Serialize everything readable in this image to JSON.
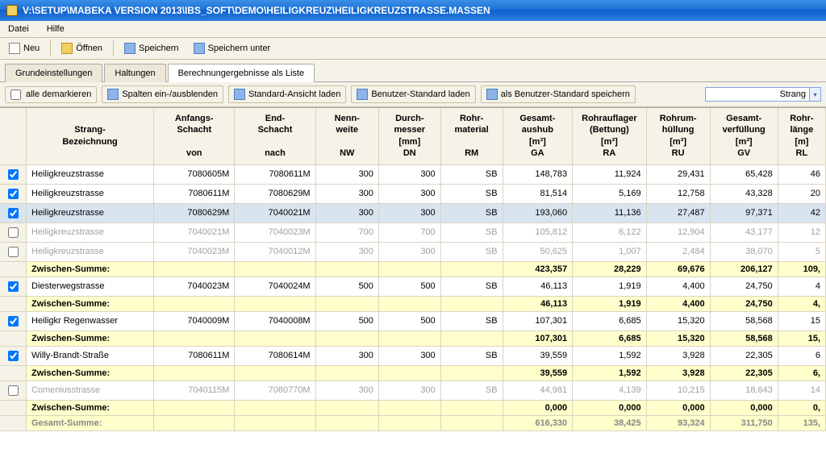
{
  "window_title": "V:\\SETUP\\MABEKA VERSION 2013\\IBS_SOFT\\DEMO\\HEILIGKREUZ\\HEILIGKREUZSTRASSE.MASSEN",
  "menu": {
    "datei": "Datei",
    "hilfe": "Hilfe"
  },
  "toolbar": {
    "neu": "Neu",
    "oeffnen": "Öffnen",
    "speichern": "Speichern",
    "speichern_unter": "Speichern unter"
  },
  "tabs": {
    "grund": "Grundeinstellungen",
    "haltungen": "Haltungen",
    "ergebnisse": "Berechnungergebnisse als Liste"
  },
  "subtoolbar": {
    "alle_demarkieren": "alle demarkieren",
    "spalten": "Spalten ein-/ausblenden",
    "standard_laden": "Standard-Ansicht laden",
    "benutzer_laden": "Benutzer-Standard laden",
    "benutzer_speichern": "als Benutzer-Standard speichern",
    "combo_value": "Strang"
  },
  "headers": {
    "strang": "Strang-\nBezeichnung",
    "anfang": "Anfangs-\nSchacht\n\nvon",
    "end": "End-\nSchacht\n\nnach",
    "nw": "Nenn-\nweite\n\nNW",
    "dn": "Durch-\nmesser\n[mm]\nDN",
    "rm": "Rohr-\nmaterial\n\nRM",
    "ga": "Gesamt-\naushub\n[m³]\nGA",
    "ra": "Rohrauflager\n(Bettung)\n[m³]\nRA",
    "ru": "Rohrum-\nhüllung\n[m³]\nRU",
    "gv": "Gesamt-\nverfüllung\n[m³]\nGV",
    "rl": "Rohr-\nlänge\n[m]\nRL"
  },
  "rows": [
    {
      "type": "data",
      "checked": true,
      "name": "Heiligkreuzstrasse",
      "von": "7080605M",
      "nach": "7080611M",
      "nw": "300",
      "dn": "300",
      "rm": "SB",
      "ga": "148,783",
      "ra": "11,924",
      "ru": "29,431",
      "gv": "65,428",
      "rl": "46"
    },
    {
      "type": "data",
      "checked": true,
      "name": "Heiligkreuzstrasse",
      "von": "7080611M",
      "nach": "7080629M",
      "nw": "300",
      "dn": "300",
      "rm": "SB",
      "ga": "81,514",
      "ra": "5,169",
      "ru": "12,758",
      "gv": "43,328",
      "rl": "20"
    },
    {
      "type": "data",
      "checked": true,
      "selected": true,
      "name": "Heiligkreuzstrasse",
      "von": "7080629M",
      "nach": "7040021M",
      "nw": "300",
      "dn": "300",
      "rm": "SB",
      "ga": "193,060",
      "ra": "11,136",
      "ru": "27,487",
      "gv": "97,371",
      "rl": "42"
    },
    {
      "type": "data",
      "checked": false,
      "disabled": true,
      "name": "Heiligkreuzstrasse",
      "von": "7040021M",
      "nach": "7040023M",
      "nw": "700",
      "dn": "700",
      "rm": "SB",
      "ga": "105,812",
      "ra": "6,122",
      "ru": "12,904",
      "gv": "43,177",
      "rl": "12"
    },
    {
      "type": "data",
      "checked": false,
      "disabled": true,
      "name": "Heiligkreuzstrasse",
      "von": "7040023M",
      "nach": "7040012M",
      "nw": "300",
      "dn": "300",
      "rm": "SB",
      "ga": "50,625",
      "ra": "1,007",
      "ru": "2,484",
      "gv": "38,070",
      "rl": "5"
    },
    {
      "type": "subtotal",
      "label": "Zwischen-Summe:",
      "ga": "423,357",
      "ra": "28,229",
      "ru": "69,676",
      "gv": "206,127",
      "rl": "109,"
    },
    {
      "type": "data",
      "checked": true,
      "name": "Diesterwegstrasse",
      "von": "7040023M",
      "nach": "7040024M",
      "nw": "500",
      "dn": "500",
      "rm": "SB",
      "ga": "46,113",
      "ra": "1,919",
      "ru": "4,400",
      "gv": "24,750",
      "rl": "4"
    },
    {
      "type": "subtotal",
      "label": "Zwischen-Summe:",
      "ga": "46,113",
      "ra": "1,919",
      "ru": "4,400",
      "gv": "24,750",
      "rl": "4,"
    },
    {
      "type": "data",
      "checked": true,
      "name": "Heiligkr Regenwasser",
      "von": "7040009M",
      "nach": "7040008M",
      "nw": "500",
      "dn": "500",
      "rm": "SB",
      "ga": "107,301",
      "ra": "6,685",
      "ru": "15,320",
      "gv": "58,568",
      "rl": "15"
    },
    {
      "type": "subtotal",
      "label": "Zwischen-Summe:",
      "ga": "107,301",
      "ra": "6,685",
      "ru": "15,320",
      "gv": "58,568",
      "rl": "15,"
    },
    {
      "type": "data",
      "checked": true,
      "name": "Willy-Brandt-Straße",
      "von": "7080611M",
      "nach": "7080614M",
      "nw": "300",
      "dn": "300",
      "rm": "SB",
      "ga": "39,559",
      "ra": "1,592",
      "ru": "3,928",
      "gv": "22,305",
      "rl": "6"
    },
    {
      "type": "subtotal",
      "label": "Zwischen-Summe:",
      "ga": "39,559",
      "ra": "1,592",
      "ru": "3,928",
      "gv": "22,305",
      "rl": "6,"
    },
    {
      "type": "data",
      "checked": false,
      "disabled": true,
      "name": "Comeniusstrasse",
      "von": "7040115M",
      "nach": "7080770M",
      "nw": "300",
      "dn": "300",
      "rm": "SB",
      "ga": "44,981",
      "ra": "4,139",
      "ru": "10,215",
      "gv": "18,643",
      "rl": "14"
    },
    {
      "type": "subtotal",
      "label": "Zwischen-Summe:",
      "ga": "0,000",
      "ra": "0,000",
      "ru": "0,000",
      "gv": "0,000",
      "rl": "0,"
    },
    {
      "type": "grand",
      "label": "Gesamt-Summe:",
      "ga": "616,330",
      "ra": "38,425",
      "ru": "93,324",
      "gv": "311,750",
      "rl": "135,"
    }
  ]
}
